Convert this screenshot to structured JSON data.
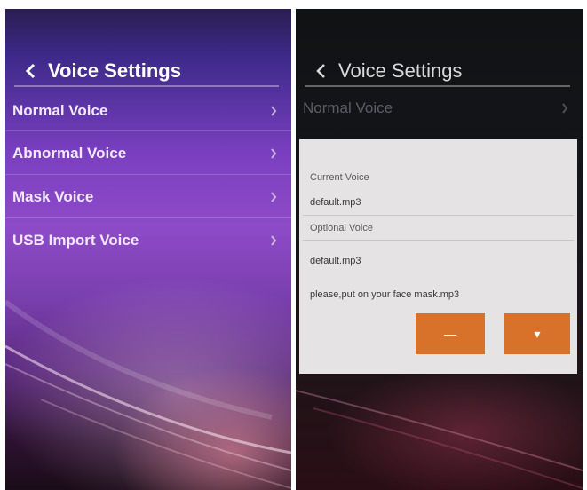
{
  "left_screen": {
    "header": {
      "title": "Voice Settings",
      "back_icon": "chevron-left-icon"
    },
    "menu": [
      {
        "label": "Normal Voice",
        "icon": "chevron-right-icon"
      },
      {
        "label": "Abnormal Voice",
        "icon": "chevron-right-icon"
      },
      {
        "label": "Mask Voice",
        "icon": "chevron-right-icon"
      },
      {
        "label": "USB Import Voice",
        "icon": "chevron-right-icon"
      }
    ]
  },
  "right_screen": {
    "header": {
      "title": "Voice Settings",
      "back_icon": "chevron-left-icon"
    },
    "menu": [
      {
        "label": "Normal Voice",
        "icon": "chevron-right-icon"
      }
    ],
    "dialog": {
      "current_voice_label": "Current Voice",
      "current_voice_value": "default.mp3",
      "optional_voice_label": "Optional Voice",
      "options": [
        "default.mp3",
        "please,put on your face mask.mp3"
      ],
      "buttons": [
        {
          "label": "—",
          "color": "#d8722a"
        },
        {
          "label": "▾",
          "color": "#d8722a"
        }
      ]
    }
  },
  "colors": {
    "accent": "#d8722a",
    "dialog_bg": "#e6e3e4"
  }
}
